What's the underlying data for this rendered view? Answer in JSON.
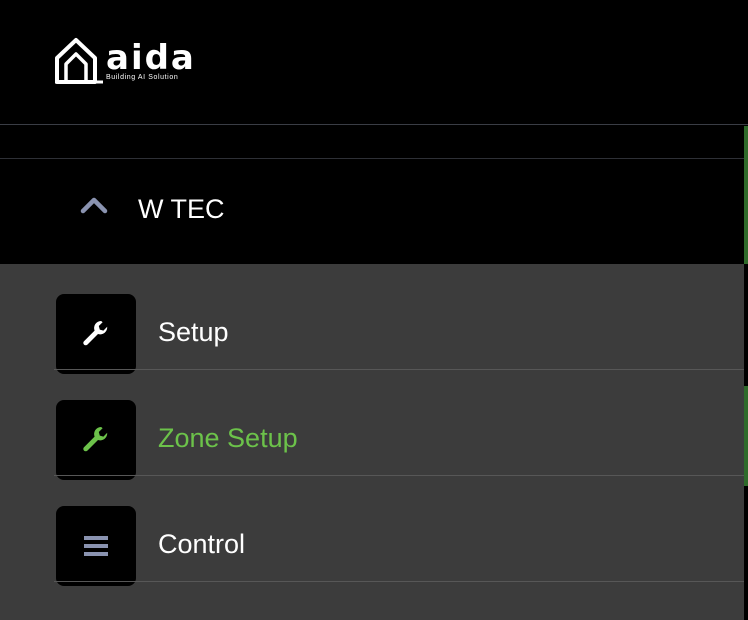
{
  "brand": {
    "name": "aida",
    "tagline": "Building AI Solution"
  },
  "site": {
    "label": "W TEC",
    "expanded": true,
    "chevron_icon": "chevron-up-icon"
  },
  "menu": {
    "items": [
      {
        "label": "Setup",
        "icon": "wrench-icon",
        "active": false
      },
      {
        "label": "Zone Setup",
        "icon": "wrench-icon",
        "active": true
      },
      {
        "label": "Control",
        "icon": "menu-icon",
        "active": false
      }
    ]
  },
  "colors": {
    "background": "#000000",
    "submenu_bg": "#3c3c3c",
    "text": "#ffffff",
    "active_text": "#6cc24a",
    "muted_icon": "#8a93b0",
    "accent_green": "#2f6a2a"
  }
}
